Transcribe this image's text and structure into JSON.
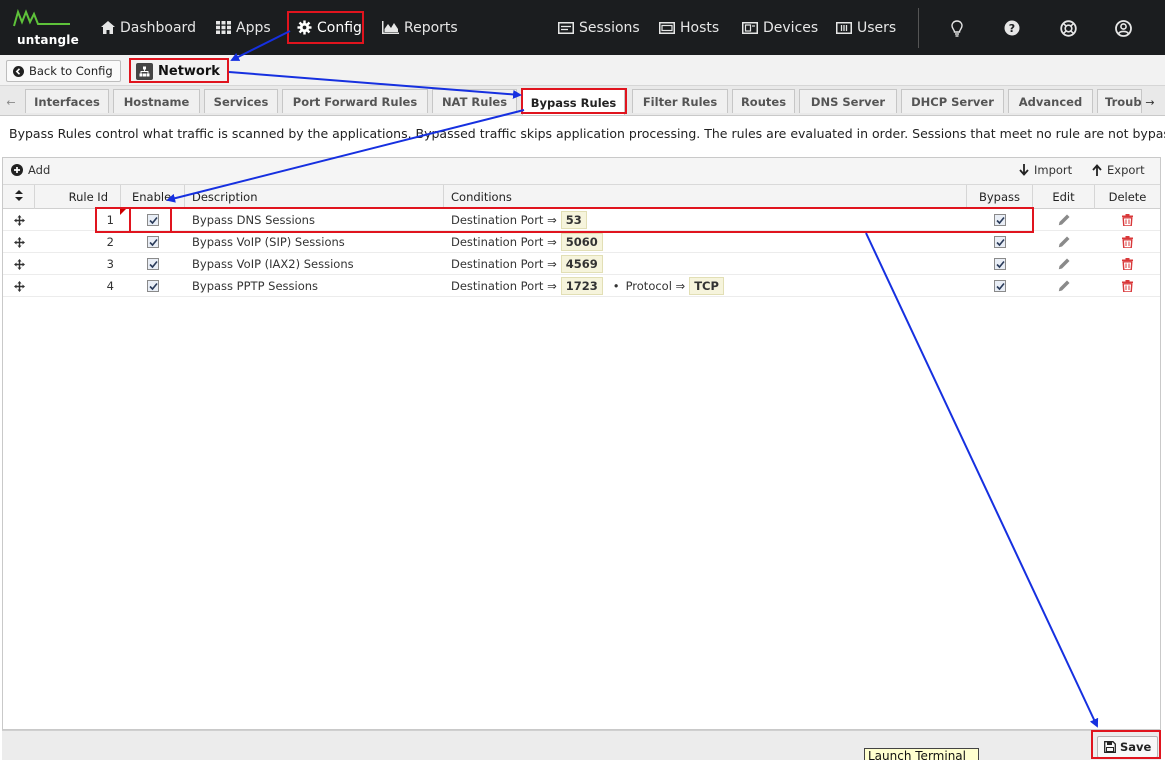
{
  "brand": {
    "logo_text": "untangle"
  },
  "nav": {
    "items": [
      {
        "label": "Dashboard",
        "icon": "home-icon"
      },
      {
        "label": "Apps",
        "icon": "grid-icon"
      },
      {
        "label": "Config",
        "icon": "gear-icon",
        "active": true
      },
      {
        "label": "Reports",
        "icon": "area-chart-icon"
      }
    ],
    "right_items": [
      {
        "label": "Sessions",
        "icon": "sessions-icon"
      },
      {
        "label": "Hosts",
        "icon": "hosts-icon"
      },
      {
        "label": "Devices",
        "icon": "devices-icon"
      },
      {
        "label": "Users",
        "icon": "users-icon"
      }
    ],
    "utility_icons": [
      "lightbulb-icon",
      "help-icon",
      "support-icon",
      "account-icon"
    ]
  },
  "breadcrumb": {
    "back_label": "Back to Config",
    "title": "Network"
  },
  "tabs": [
    {
      "label": "Interfaces"
    },
    {
      "label": "Hostname"
    },
    {
      "label": "Services"
    },
    {
      "label": "Port Forward Rules"
    },
    {
      "label": "NAT Rules"
    },
    {
      "label": "Bypass Rules",
      "active": true
    },
    {
      "label": "Filter Rules"
    },
    {
      "label": "Routes"
    },
    {
      "label": "DNS Server"
    },
    {
      "label": "DHCP Server"
    },
    {
      "label": "Advanced"
    },
    {
      "label": "Troubleshooting"
    }
  ],
  "description": "Bypass Rules control what traffic is scanned by the applications. Bypassed traffic skips application processing. The rules are evaluated in order. Sessions that meet no rule are not bypassed.",
  "toolbar": {
    "add_label": "Add",
    "import_label": "Import",
    "export_label": "Export"
  },
  "columns": {
    "rule_id": "Rule Id",
    "enable": "Enable",
    "description": "Description",
    "conditions": "Conditions",
    "bypass": "Bypass",
    "edit": "Edit",
    "delete": "Delete"
  },
  "rows": [
    {
      "rule_id": "1",
      "enable": true,
      "description": "Bypass DNS Sessions",
      "conditions": [
        {
          "label": "Destination Port ⇒",
          "value": "53"
        }
      ],
      "bypass": true
    },
    {
      "rule_id": "2",
      "enable": true,
      "description": "Bypass VoIP (SIP) Sessions",
      "conditions": [
        {
          "label": "Destination Port ⇒",
          "value": "5060"
        }
      ],
      "bypass": true
    },
    {
      "rule_id": "3",
      "enable": true,
      "description": "Bypass VoIP (IAX2) Sessions",
      "conditions": [
        {
          "label": "Destination Port ⇒",
          "value": "4569"
        }
      ],
      "bypass": true
    },
    {
      "rule_id": "4",
      "enable": true,
      "description": "Bypass PPTP Sessions",
      "conditions": [
        {
          "label": "Destination Port ⇒",
          "value": "1723"
        },
        {
          "label": "Protocol ⇒",
          "value": "TCP"
        }
      ],
      "bypass": true
    }
  ],
  "condition_separator": "•",
  "save_label": "Save",
  "tooltip": "Launch Terminal",
  "colors": {
    "nav_bg": "#1b1d1f",
    "highlight": "#e0141e",
    "annotation_arrow": "#1630e0",
    "delete_red": "#d9383a",
    "value_bg": "#f6f4dc"
  }
}
